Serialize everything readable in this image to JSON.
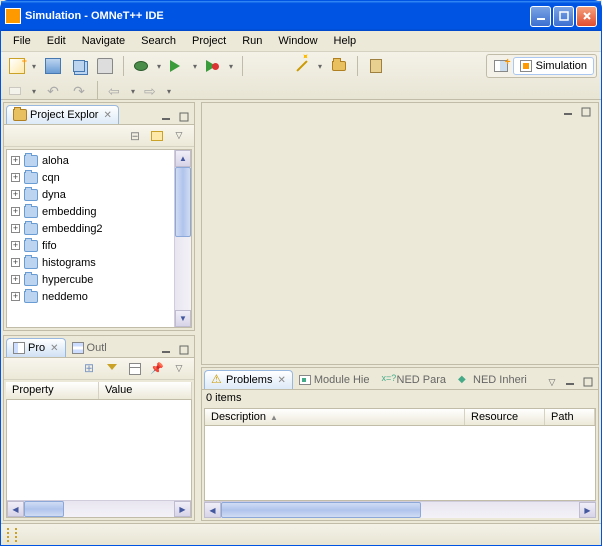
{
  "window": {
    "title": "Simulation - OMNeT++ IDE"
  },
  "menu": {
    "file": "File",
    "edit": "Edit",
    "navigate": "Navigate",
    "search": "Search",
    "project": "Project",
    "run": "Run",
    "window": "Window",
    "help": "Help"
  },
  "perspective": {
    "label": "Simulation"
  },
  "explorer": {
    "tab": "Project Explor",
    "items": [
      {
        "label": "aloha"
      },
      {
        "label": "cqn"
      },
      {
        "label": "dyna"
      },
      {
        "label": "embedding"
      },
      {
        "label": "embedding2"
      },
      {
        "label": "fifo"
      },
      {
        "label": "histograms"
      },
      {
        "label": "hypercube"
      },
      {
        "label": "neddemo"
      }
    ]
  },
  "outline": {
    "tab": "Outl"
  },
  "properties": {
    "tab": "Pro",
    "cols": {
      "property": "Property",
      "value": "Value"
    }
  },
  "problems": {
    "tab": "Problems",
    "moduleTab": "Module Hie",
    "nedParaTab": "NED Para",
    "nedInheriTab": "NED Inheri",
    "items_label": "0 items",
    "cols": {
      "description": "Description",
      "resource": "Resource",
      "path": "Path"
    }
  }
}
